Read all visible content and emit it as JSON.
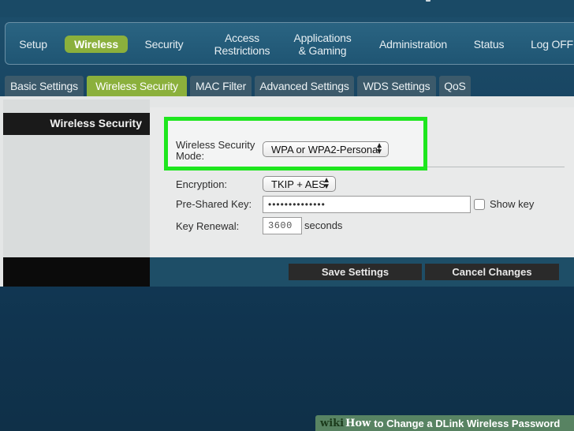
{
  "menu": {
    "items": [
      {
        "label": "Setup"
      },
      {
        "label": "Wireless"
      },
      {
        "label": "Security"
      },
      {
        "label": "Access\nRestrictions"
      },
      {
        "label": "Applications\n& Gaming"
      },
      {
        "label": "Administration"
      },
      {
        "label": "Status"
      },
      {
        "label": "Log OFF"
      }
    ],
    "active": "Wireless"
  },
  "subtabs": {
    "items": [
      {
        "label": "Basic Settings"
      },
      {
        "label": "Wireless Security"
      },
      {
        "label": "MAC Filter"
      },
      {
        "label": "Advanced Settings"
      },
      {
        "label": "WDS Settings"
      },
      {
        "label": "QoS"
      }
    ],
    "active": "Wireless Security"
  },
  "sidebar": {
    "title": "Wireless Security"
  },
  "form": {
    "mode_label_line1": "Wireless Security",
    "mode_label_line2": "Mode:",
    "mode_value": "WPA or WPA2-Personal",
    "encryption_label": "Encryption:",
    "encryption_value": "TKIP + AES",
    "psk_label": "Pre-Shared Key:",
    "psk_value": "••••••••••••••",
    "show_key_label": "Show key",
    "show_key_checked": false,
    "renewal_label": "Key Renewal:",
    "renewal_value": "3600",
    "renewal_unit": "seconds"
  },
  "buttons": {
    "save": "Save Settings",
    "cancel": "Cancel Changes"
  },
  "watermark": {
    "logo_a": "wiki",
    "logo_b": "How",
    "text": "to Change a DLink Wireless Password"
  },
  "colors": {
    "accent": "#8bb03c",
    "highlight": "#1ee61e",
    "background": "#153f5c"
  }
}
